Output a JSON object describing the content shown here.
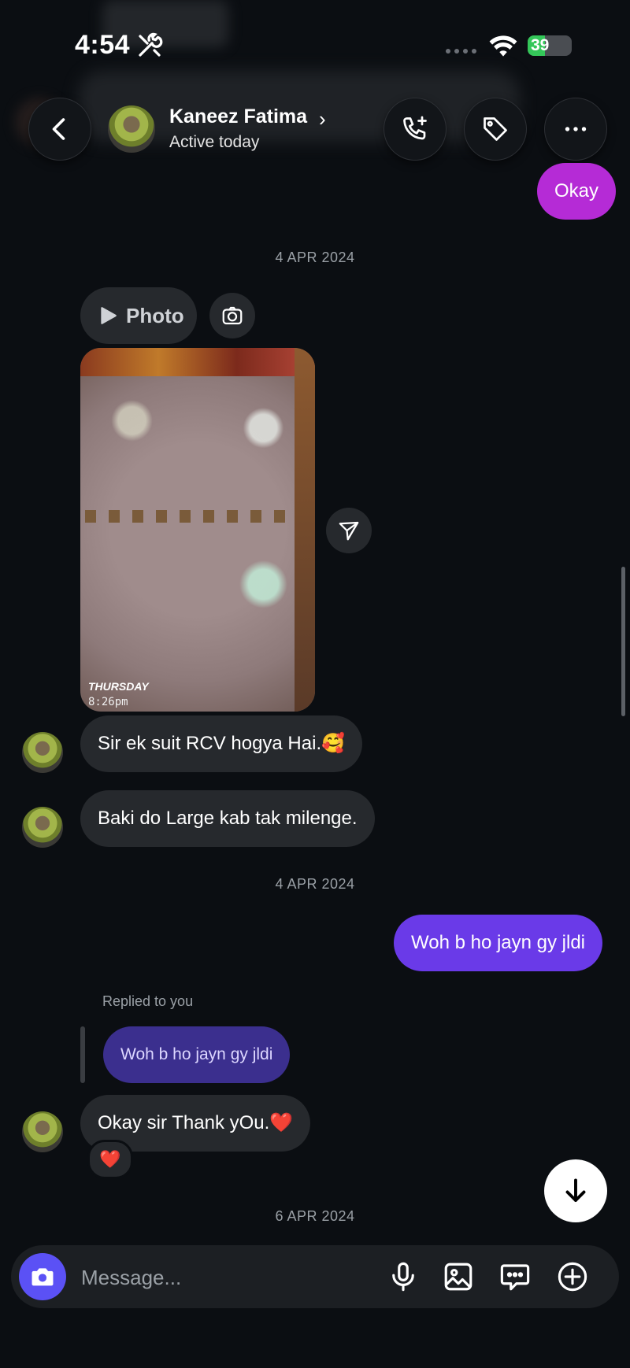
{
  "status_bar": {
    "time": "4:54",
    "battery": "39",
    "battery_level": 0.39
  },
  "header": {
    "name": "Kaneez Fatima",
    "subtitle": "Active today"
  },
  "messages": {
    "okay": "Okay",
    "date1": "4 APR 2024",
    "photo_label": "Photo",
    "photo_day": "THURSDAY",
    "photo_time": "8:26pm",
    "msg1": "Sir ek suit RCV hogya Hai.🥰",
    "msg2": "Baki do Large kab tak milenge.",
    "date2": "4 APR 2024",
    "out1": "Woh b ho jayn gy jldi",
    "replied_label": "Replied to you",
    "quoted": "Woh b ho jayn gy jldi",
    "msg3": "Okay sir Thank yOu.❤️",
    "reaction": "❤️",
    "date3": "6 APR 2024"
  },
  "composer": {
    "placeholder": "Message..."
  },
  "colors": {
    "outgoing_pink": "#b52bd6",
    "outgoing_purple": "#6a3ae8",
    "incoming": "#26292d",
    "camera": "#5b51f5"
  }
}
